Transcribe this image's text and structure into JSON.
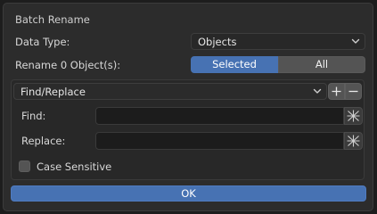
{
  "dialog": {
    "title": "Batch Rename",
    "data_type_label": "Data Type:",
    "data_type_value": "Objects",
    "rename_label": "Rename 0 Object(s):",
    "scope_options": [
      "Selected",
      "All"
    ],
    "scope_selected": "Selected",
    "operation": "Find/Replace",
    "find_label": "Find:",
    "find_value": "",
    "replace_label": "Replace:",
    "replace_value": "",
    "case_sensitive_label": "Case Sensitive",
    "case_sensitive_checked": false,
    "ok_label": "OK"
  },
  "icons": {
    "add": "plus-icon",
    "remove": "minus-icon",
    "dropdown": "chevron-down-icon",
    "eyedropper": "eyedropper-icon"
  },
  "colors": {
    "accent": "#4772b3",
    "panel": "#2c2c2c",
    "field": "#1c1c1c"
  }
}
